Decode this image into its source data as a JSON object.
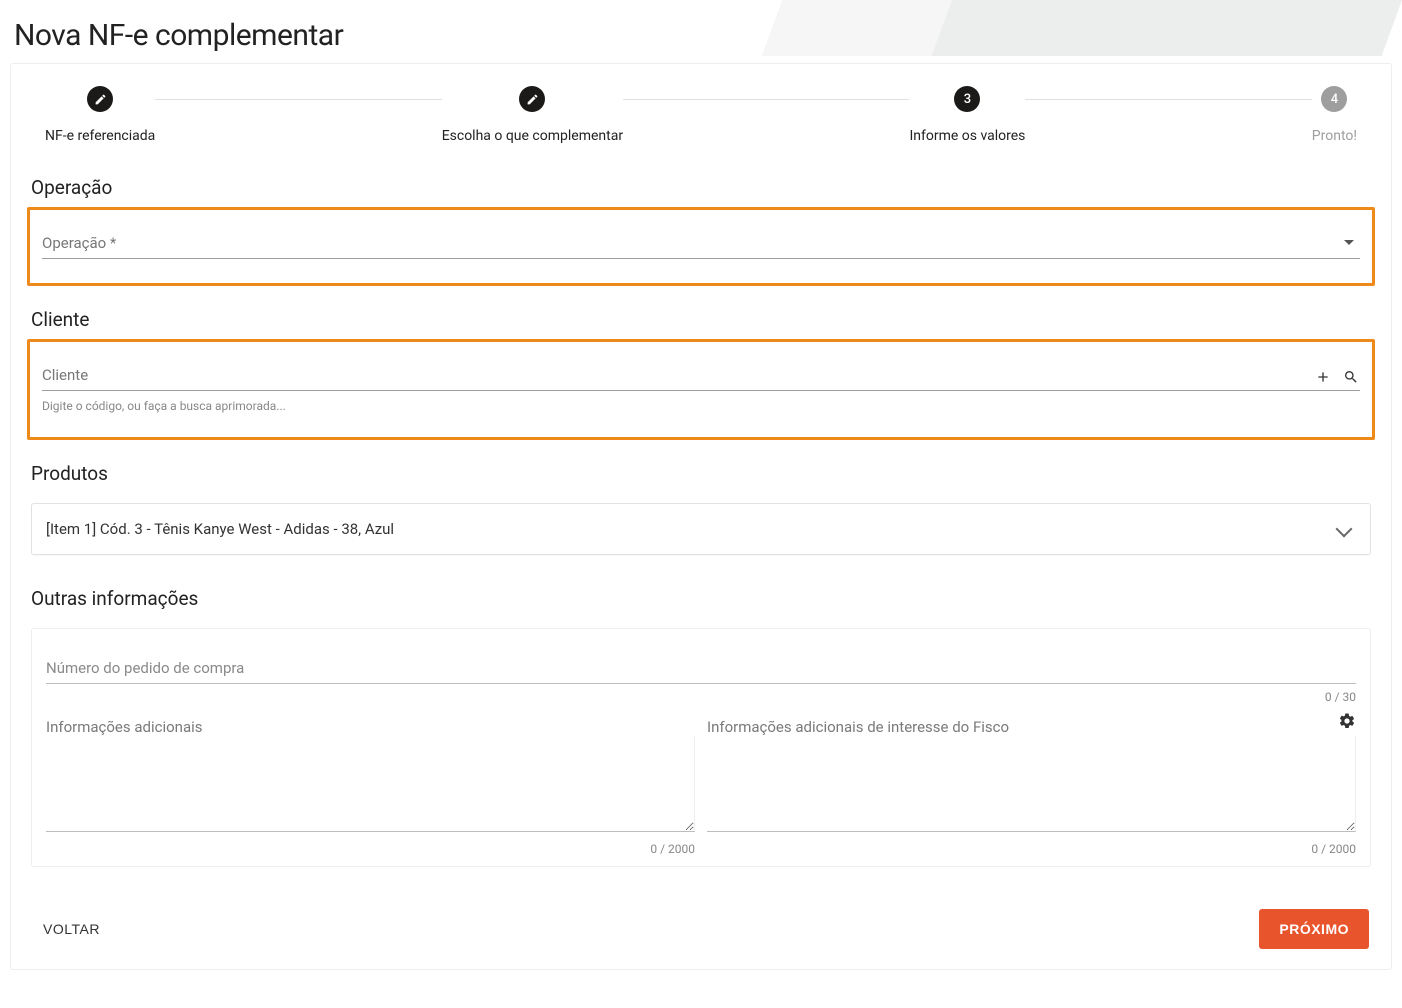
{
  "page": {
    "title": "Nova NF-e complementar"
  },
  "stepper": {
    "steps": [
      {
        "label": "NF-e referenciada",
        "icon": "edit",
        "active": true
      },
      {
        "label": "Escolha o que complementar",
        "icon": "edit",
        "active": true
      },
      {
        "label": "Informe os valores",
        "number": "3",
        "active": true
      },
      {
        "label": "Pronto!",
        "number": "4",
        "active": false
      }
    ]
  },
  "sections": {
    "operacao": {
      "title": "Operação",
      "field_label": "Operação *"
    },
    "cliente": {
      "title": "Cliente",
      "field_label": "Cliente",
      "helper": "Digite o código, ou faça a busca aprimorada..."
    },
    "produtos": {
      "title": "Produtos",
      "item": "[Item 1] Cód. 3 - Tênis Kanye West - Adidas - 38, Azul"
    },
    "outras": {
      "title": "Outras informações",
      "pedido_label": "Número do pedido de compra",
      "pedido_counter": "0 / 30",
      "info_adicionais_label": "Informações adicionais",
      "info_fisco_label": "Informações adicionais de interesse do Fisco",
      "info_counter": "0 / 2000",
      "fisco_counter": "0 / 2000"
    }
  },
  "actions": {
    "back": "VOLTAR",
    "next": "PRÓXIMO"
  },
  "colors": {
    "highlight": "#ed8a19",
    "primary": "#e8542c"
  }
}
